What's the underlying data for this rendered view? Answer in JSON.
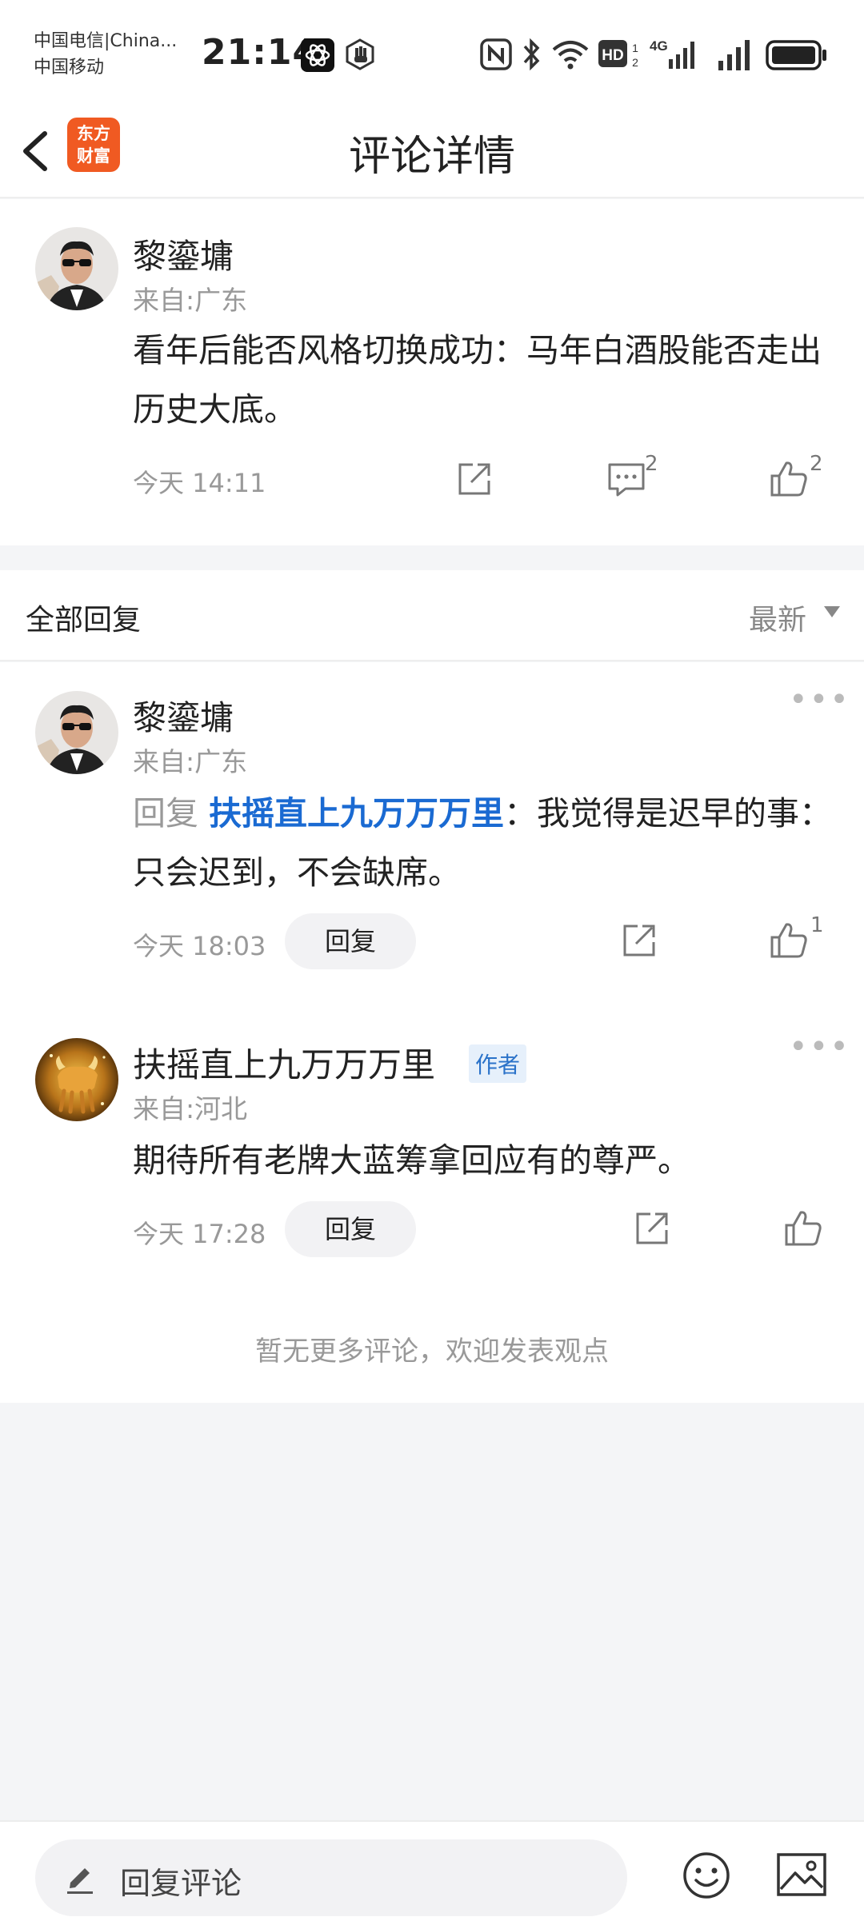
{
  "status_bar": {
    "carrier1": "中国电信|China...",
    "carrier2": "中国移动",
    "time": "21:14",
    "icons": [
      "app-icon-atom",
      "hand-icon",
      "nfc-icon",
      "bluetooth-icon",
      "wifi-icon",
      "hd-icon",
      "signal-4g-icon",
      "signal-icon",
      "battery-icon"
    ]
  },
  "header": {
    "title": "评论详情",
    "logo_line1": "东方",
    "logo_line2": "财富"
  },
  "main_comment": {
    "user": "黎鎏墉",
    "location": "来自:广东",
    "text": "看年后能否风格切换成功：马年白酒股能否走出历史大底。",
    "time": "今天 14:11",
    "comment_count": "2",
    "like_count": "2"
  },
  "replies_header": {
    "title": "全部回复",
    "sort": "最新"
  },
  "replies": [
    {
      "user": "黎鎏墉",
      "location": "来自:广东",
      "reply_prefix": "回复 ",
      "reply_target": "扶摇直上九万万万里",
      "text": "：我觉得是迟早的事：只会迟到，不会缺席。",
      "time": "今天 18:03",
      "reply_button": "回复",
      "like_count": "1"
    },
    {
      "user": "扶摇直上九万万万里",
      "badge": "作者",
      "location": "来自:河北",
      "text": "期待所有老牌大蓝筹拿回应有的尊严。",
      "time": "今天 17:28",
      "reply_button": "回复"
    }
  ],
  "no_more_text": "暂无更多评论，欢迎发表观点",
  "bottom_bar": {
    "placeholder": "回复评论"
  },
  "colors": {
    "brand": "#f05a22",
    "link": "#1a6ad2",
    "author_badge": "#2a72c9"
  }
}
